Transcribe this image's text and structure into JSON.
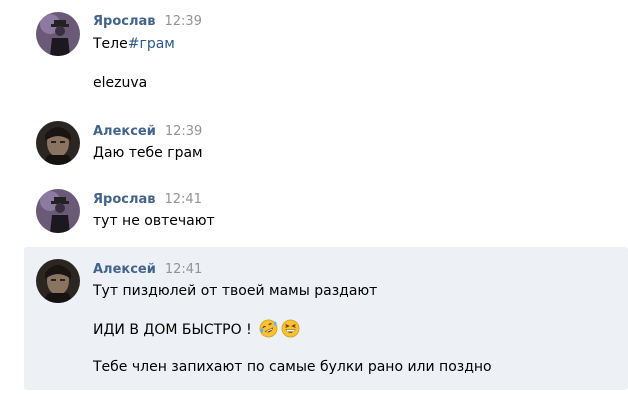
{
  "messages": [
    {
      "author": "Ярослав",
      "time": "12:39",
      "lines": [
        {
          "prefix": "Теле",
          "hashtag": "#грам"
        },
        {
          "text": "elezuva"
        }
      ]
    },
    {
      "author": "Алексей",
      "time": "12:39",
      "lines": [
        {
          "text": "Даю тебе грам"
        }
      ]
    },
    {
      "author": "Ярослав",
      "time": "12:41",
      "lines": [
        {
          "text": "тут не овтечают"
        }
      ]
    },
    {
      "author": "Алексей",
      "time": "12:41",
      "highlighted": true,
      "lines": [
        {
          "text": "Тут пиздюлей от твоей мамы раздают"
        },
        {
          "text": "ИДИ В ДОМ БЫСТРО !",
          "emojis": [
            "rolling-on-floor-laughing-emoji",
            "grinning-squinting-face-emoji"
          ]
        },
        {
          "text": "Тебе член запихают по самые булки рано или поздно"
        }
      ]
    }
  ],
  "colors": {
    "author": "#42648b",
    "time": "#939393",
    "hashtag": "#2a5885",
    "highlight_bg": "#edf0f5",
    "emoji_yellow": "#f7c232"
  }
}
